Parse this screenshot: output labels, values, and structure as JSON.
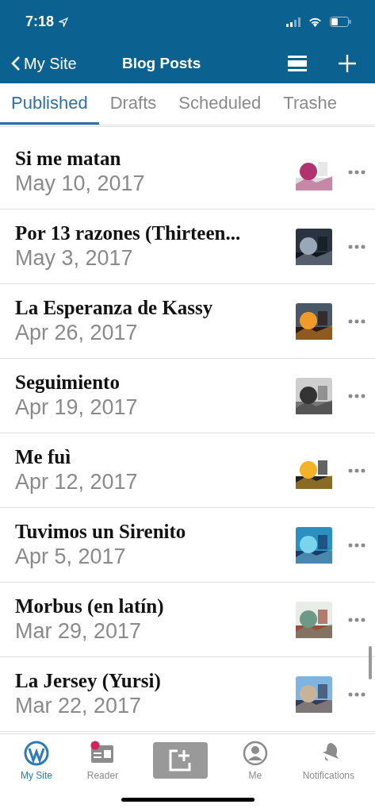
{
  "status_bar": {
    "time": "7:18"
  },
  "nav": {
    "back": "My Site",
    "title": "Blog Posts"
  },
  "tabs": [
    {
      "label": "Published",
      "selected": true
    },
    {
      "label": "Drafts",
      "selected": false
    },
    {
      "label": "Scheduled",
      "selected": false
    },
    {
      "label": "Trashe",
      "selected": false
    }
  ],
  "posts": [
    {
      "title": "Si me matan",
      "date": "May 10, 2017"
    },
    {
      "title": "Por 13 razones (Thirteen...",
      "date": "May 3, 2017"
    },
    {
      "title": "La Esperanza de Kassy",
      "date": "Apr 26, 2017"
    },
    {
      "title": "Seguimiento",
      "date": "Apr 19, 2017"
    },
    {
      "title": "Me fuì",
      "date": "Apr 12, 2017"
    },
    {
      "title": "Tuvimos un Sirenito",
      "date": "Apr 5, 2017"
    },
    {
      "title": "Morbus (en latín)",
      "date": "Mar 29, 2017"
    },
    {
      "title": "La Jersey (Yursi)",
      "date": "Mar 22, 2017"
    }
  ],
  "tab_bar": [
    {
      "kind": "site",
      "label": "My Site",
      "selected": true
    },
    {
      "kind": "reader",
      "label": "Reader",
      "selected": false
    },
    {
      "kind": "write"
    },
    {
      "kind": "me",
      "label": "Me",
      "selected": false
    },
    {
      "kind": "notifications",
      "label": "Notifications",
      "selected": false
    }
  ]
}
